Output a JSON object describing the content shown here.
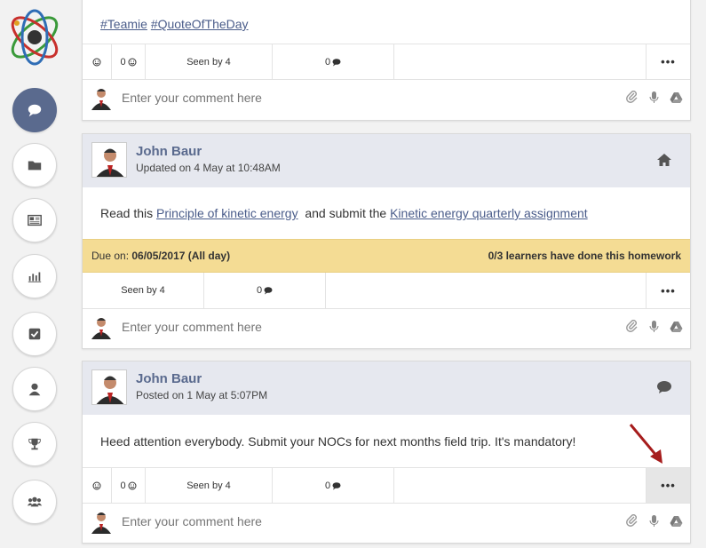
{
  "posts": [
    {
      "body_tags": [
        "#Teamie",
        "#QuoteOfTheDay"
      ],
      "actions": {
        "smile": "",
        "smile_count": "0",
        "seen": "Seen by 4",
        "comments": "0",
        "more": "•••"
      },
      "comment_placeholder": "Enter your comment here"
    },
    {
      "author": "John Baur",
      "meta": "Updated on 4 May at 10:48AM",
      "body_prefix": "Read this ",
      "link1": "Principle of kinetic energy",
      "body_mid": "  and submit the ",
      "link2": "Kinetic energy quarterly assignment",
      "due_label": "Due on: ",
      "due_value": "06/05/2017 (All day)",
      "due_status": "0/3 learners have done this homework",
      "actions": {
        "seen": "Seen by 4",
        "comments": "0",
        "more": "•••"
      },
      "comment_placeholder": "Enter your comment here"
    },
    {
      "author": "John Baur",
      "meta": "Posted on 1 May at 5:07PM",
      "body": "Heed attention everybody. Submit your NOCs for next months field trip. It's mandatory!",
      "actions": {
        "smile_count": "0",
        "seen": "Seen by 4",
        "comments": "0",
        "more": "•••"
      },
      "comment_placeholder": "Enter your comment here"
    }
  ],
  "colors": {
    "accent": "#5a6a8e",
    "due": "#f4dc94",
    "header": "#e6e8ef",
    "arrow": "#a61c1c"
  },
  "sidebar": [
    "chat-icon",
    "folder-icon",
    "newspaper-icon",
    "chart-icon",
    "checkbox-icon",
    "user-icon",
    "trophy-icon",
    "group-icon"
  ]
}
